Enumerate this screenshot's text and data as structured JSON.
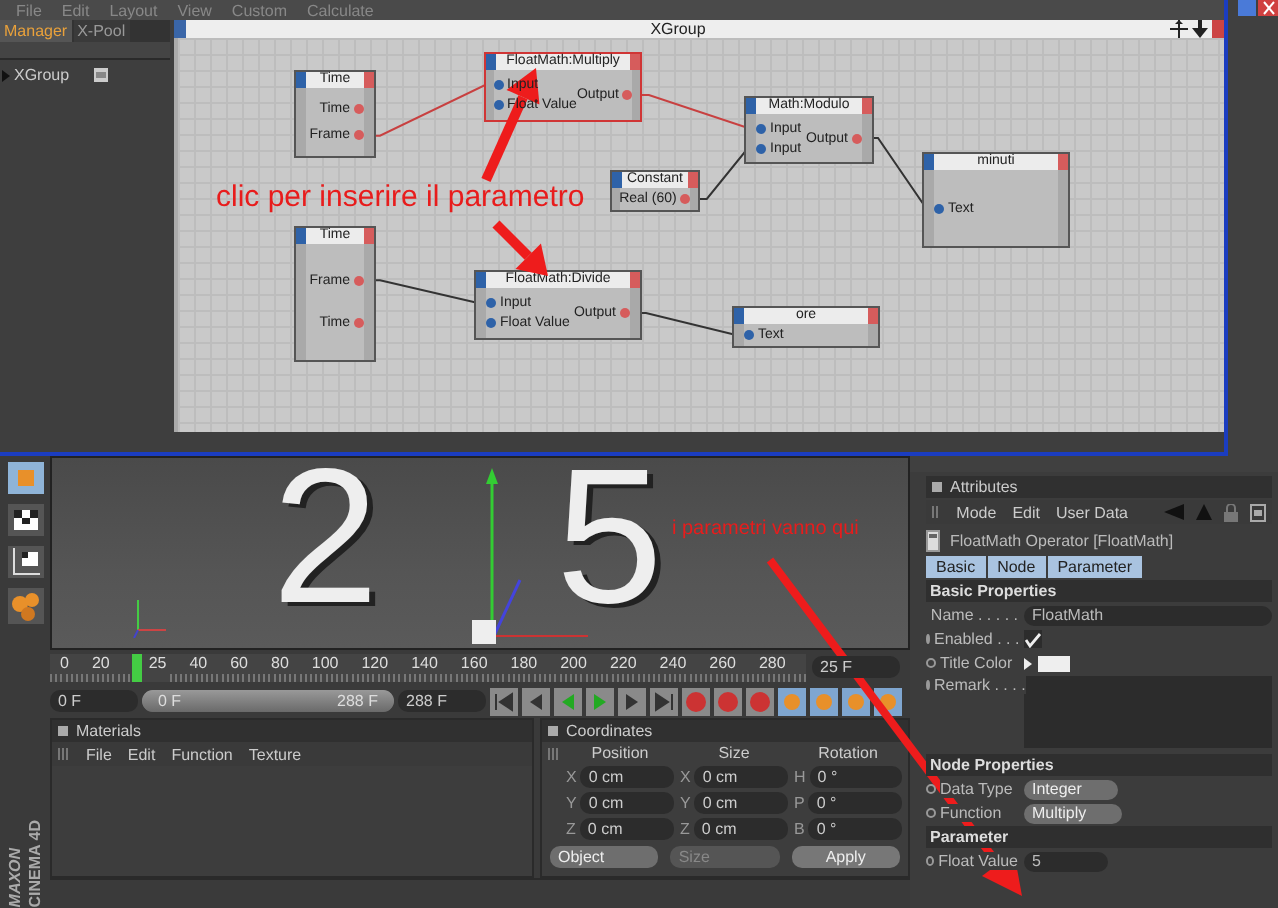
{
  "menu": [
    "File",
    "Edit",
    "Layout",
    "View",
    "Custom",
    "Calculate"
  ],
  "manager": {
    "tabs": [
      {
        "label": "Manager",
        "selected": true
      },
      {
        "label": "X-Pool",
        "selected": false
      }
    ],
    "tree": [
      {
        "label": "XGroup"
      }
    ]
  },
  "xgroup": {
    "title": "XGroup",
    "nodes": [
      {
        "title": "Time",
        "selected": false,
        "outputs": [
          "Time",
          "Frame"
        ]
      },
      {
        "title": "FloatMath:Multiply",
        "selected": true,
        "inputs": [
          "Input",
          "Float Value"
        ],
        "outputs": [
          "Output"
        ]
      },
      {
        "title": "Math:Modulo",
        "selected": false,
        "inputs": [
          "Input",
          "Input"
        ],
        "outputs": [
          "Output"
        ]
      },
      {
        "title": "Constant",
        "selected": false,
        "outputs": [
          "Real (60)"
        ]
      },
      {
        "title": "minuti",
        "selected": false,
        "inputs": [
          "Text"
        ]
      },
      {
        "title": "Time",
        "selected": false,
        "outputs": [
          "Frame",
          "Time"
        ]
      },
      {
        "title": "FloatMath:Divide",
        "selected": false,
        "inputs": [
          "Input",
          "Float Value"
        ],
        "outputs": [
          "Output"
        ]
      },
      {
        "title": "ore",
        "selected": false,
        "inputs": [
          "Text"
        ]
      }
    ]
  },
  "annotations": [
    {
      "text": "clic per inserire il parametro"
    },
    {
      "text": "i parametri vanno qui"
    }
  ],
  "viewport": {
    "glyphs": [
      "2",
      "5"
    ]
  },
  "timeline": {
    "ticks": [
      "0",
      "20",
      "40",
      "60",
      "80",
      "100",
      "120",
      "140",
      "160",
      "180",
      "200",
      "220",
      "240",
      "260",
      "280"
    ],
    "current": "25",
    "frame_field": "25 F"
  },
  "transport": {
    "start": "0 F",
    "range": {
      "start": "0 F",
      "end": "288 F",
      "level": 1
    },
    "end": "288 F"
  },
  "materials": {
    "title": "Materials",
    "menu": [
      "File",
      "Edit",
      "Function",
      "Texture"
    ]
  },
  "coordinates": {
    "title": "Coordinates",
    "columns": [
      "Position",
      "Size",
      "Rotation"
    ],
    "rows": [
      [
        {
          "axis": "X",
          "value": "0 cm"
        },
        {
          "axis": "X",
          "value": "0 cm"
        },
        {
          "axis": "H",
          "value": "0 °"
        }
      ],
      [
        {
          "axis": "Y",
          "value": "0 cm"
        },
        {
          "axis": "Y",
          "value": "0 cm"
        },
        {
          "axis": "P",
          "value": "0 °"
        }
      ],
      [
        {
          "axis": "Z",
          "value": "0 cm"
        },
        {
          "axis": "Z",
          "value": "0 cm"
        },
        {
          "axis": "B",
          "value": "0 °"
        }
      ]
    ],
    "mode": {
      "label": "Object",
      "disabled": false
    },
    "size_mode": {
      "label": "Size",
      "disabled": true
    },
    "apply": "Apply"
  },
  "attributes": {
    "title": "Attributes",
    "menu": [
      "Mode",
      "Edit",
      "User Data"
    ],
    "object": "FloatMath Operator [FloatMath]",
    "tabs": [
      {
        "label": "Basic",
        "selected": true
      },
      {
        "label": "Node",
        "selected": true
      },
      {
        "label": "Parameter",
        "selected": true
      }
    ],
    "sections": [
      {
        "title": "Basic Properties",
        "fields": [
          {
            "kind": "text",
            "label": "Name . . . . .",
            "value": "FloatMath",
            "animatable": false
          },
          {
            "kind": "check",
            "label": "Enabled . . .",
            "checked": true,
            "animatable": true
          },
          {
            "kind": "color",
            "label": "Title Color",
            "color": "#eeeeee",
            "animatable": true
          },
          {
            "kind": "textarea",
            "label": "Remark . . . .",
            "animatable": true
          }
        ]
      },
      {
        "title": "Node Properties",
        "fields": [
          {
            "kind": "select",
            "label": "Data Type",
            "value": "Integer",
            "animatable": true
          },
          {
            "kind": "select",
            "label": "Function",
            "value": "Multiply",
            "animatable": true
          }
        ]
      },
      {
        "title": "Parameter",
        "fields": [
          {
            "kind": "number",
            "label": "Float Value",
            "value": "5",
            "animatable": true
          }
        ]
      }
    ]
  },
  "brand": {
    "line1": "MAXON",
    "line2": "CINEMA 4D"
  }
}
